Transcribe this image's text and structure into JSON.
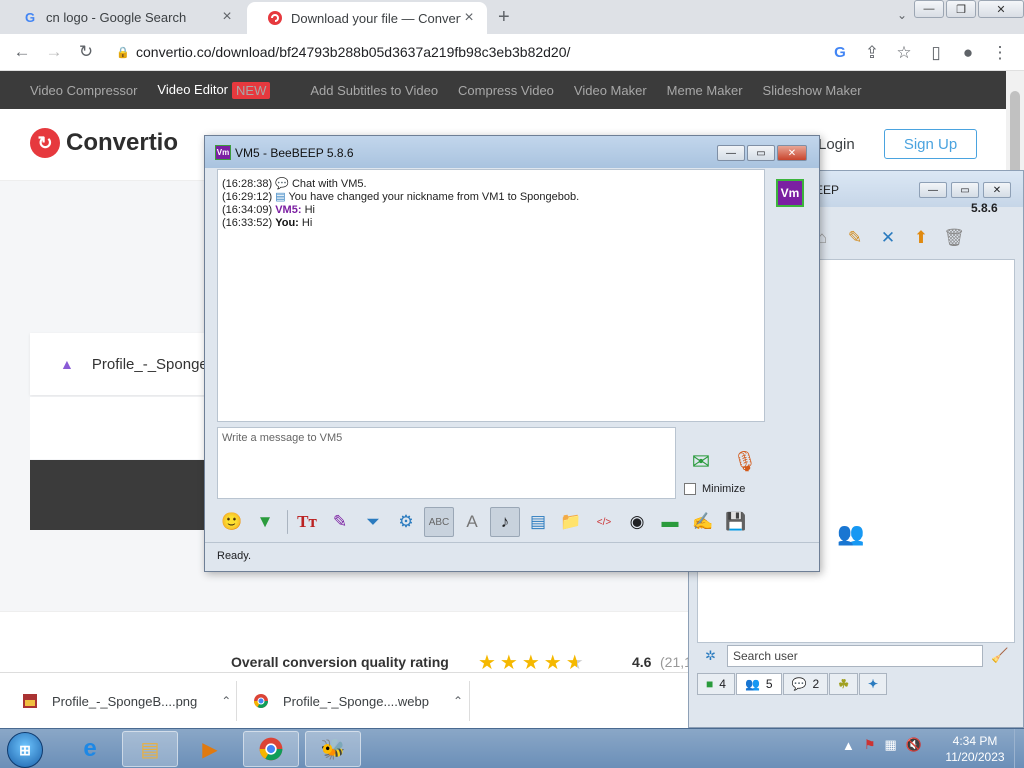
{
  "browser": {
    "tabs": [
      {
        "title": "cn logo - Google Search",
        "favicon": "google-g-icon",
        "active": false
      },
      {
        "title": "Download your file — Convertio",
        "favicon": "convertio-icon",
        "active": true
      }
    ],
    "url": "convertio.co/download/bf24793b288b05d3637a219fb98c3eb3b82d20/"
  },
  "site": {
    "nav": [
      {
        "label": "Video Compressor"
      },
      {
        "label": "Video Editor",
        "badge": "NEW"
      },
      {
        "label": "Add Subtitles to Video"
      },
      {
        "label": "Compress Video"
      },
      {
        "label": "Video Maker"
      },
      {
        "label": "Meme Maker"
      },
      {
        "label": "Slideshow Maker"
      }
    ],
    "logo_text": "Convertio",
    "login_label": "Login",
    "signup_label": "Sign Up",
    "file_name": "Profile_-_Sponge",
    "rating_label": "Overall conversion quality rating",
    "rating_value": "4.6",
    "rating_count": "(21,1",
    "rating_stars": 4.5
  },
  "downloads": [
    {
      "name": "Profile_-_SpongeB....png"
    },
    {
      "name": "Profile_-_Sponge....webp"
    }
  ],
  "beebeep_main": {
    "title": "EEP",
    "version": "5.8.6",
    "search_placeholder": "Search user",
    "tabs": [
      {
        "count": "4"
      },
      {
        "count": "5"
      },
      {
        "count": "2"
      }
    ]
  },
  "chat": {
    "title": "VM5 - BeeBEEP 5.8.6",
    "avatar_text": "Vm",
    "app_icon_text": "Vm",
    "messages": [
      {
        "time": "(16:28:38)",
        "who": "",
        "text": "Chat with VM5."
      },
      {
        "time": "(16:29:12)",
        "who": "",
        "text": "You have changed your nickname from VM1 to Spongebob."
      },
      {
        "time": "(16:34:09)",
        "who": "VM5:",
        "text": "Hi"
      },
      {
        "time": "(16:33:52)",
        "who": "You:",
        "text": "Hi"
      }
    ],
    "input_placeholder": "Write a message to VM5",
    "minimize_label": "Minimize",
    "status": "Ready."
  },
  "taskbar": {
    "time": "4:34 PM",
    "date": "11/20/2023"
  },
  "colors": {
    "convertio_red": "#e6393e",
    "signup_blue": "#4aa3df",
    "vm_purple": "#7b1fa2",
    "star_gold": "#f5b800"
  }
}
